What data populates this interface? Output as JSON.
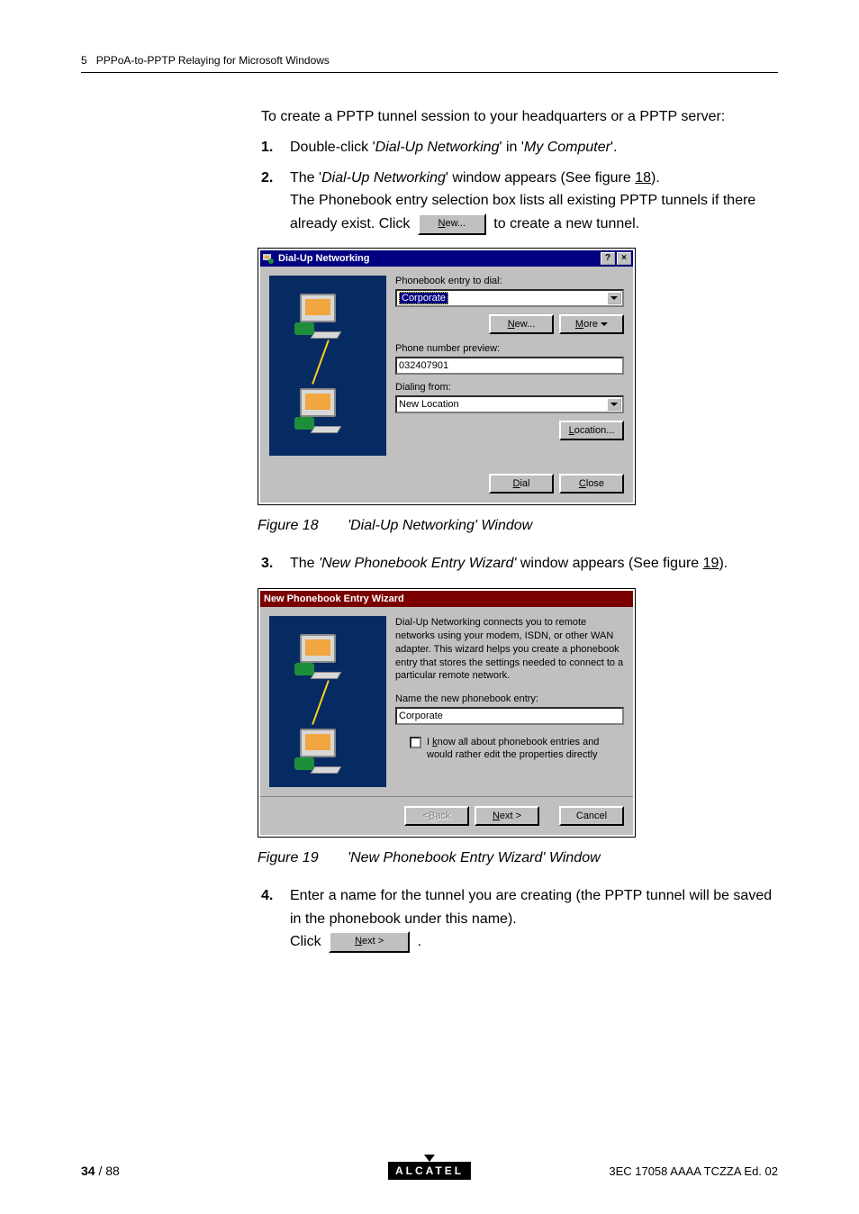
{
  "header": {
    "chapter_num": "5",
    "chapter_title": "PPPoA-to-PPTP Relaying for Microsoft Windows"
  },
  "intro": "To create a PPTP tunnel session to your headquarters or a PPTP server:",
  "steps": {
    "s1": {
      "num": "1.",
      "text_a": "Double-click '",
      "italic_1": "Dial-Up Networking",
      "text_b": "' in '",
      "italic_2": "My Computer",
      "text_c": "'."
    },
    "s2": {
      "num": "2.",
      "line1_a": "The '",
      "line1_i": "Dial-Up Networking",
      "line1_b": "' window appears (See figure ",
      "line1_link": "18",
      "line1_c": ").",
      "line2": "The Phonebook entry selection box lists all existing PPTP tunnels if there already exist. Click",
      "line2_btn_u": "N",
      "line2_btn_rest": "ew...",
      "line2_tail": "to create a new tunnel."
    },
    "s3": {
      "num": "3.",
      "text_a": "The ",
      "italic_1": "'New Phonebook Entry Wizard'",
      "text_b": " window appears (See figure ",
      "link": "19",
      "text_c": ")."
    },
    "s4": {
      "num": "4.",
      "line1": "Enter a name for the tunnel you are creating (the PPTP tunnel will be saved in the phonebook under this name).",
      "line2_pre": "Click",
      "btn_u": "N",
      "btn_rest": "ext >",
      "line2_post": "."
    }
  },
  "fig18": {
    "title": "Dial-Up Networking",
    "label_phonebook": "Phonebook entry to dial:",
    "combo_value": "Corporate",
    "btn_new_u": "N",
    "btn_new_rest": "ew...",
    "btn_more_u": "M",
    "btn_more_rest": "ore",
    "label_phone": "Phone number preview:",
    "phone_value": "032407901",
    "label_from": "Dialing from:",
    "from_value": "New Location",
    "btn_location_u": "L",
    "btn_location_rest": "ocation...",
    "btn_dial_u": "D",
    "btn_dial_rest": "ial",
    "btn_close_u": "C",
    "btn_close_rest": "lose",
    "caption_label": "Figure 18",
    "caption_text": "'Dial-Up Networking' Window"
  },
  "fig19": {
    "title": "New Phonebook Entry Wizard",
    "wiz_text": "Dial-Up Networking connects you to remote networks using your modem, ISDN, or other WAN adapter. This wizard helps you create a phonebook entry that stores the settings needed to connect to a particular remote network.",
    "label_name": "Name the new phonebook entry:",
    "entry_value": "Corporate",
    "check_label_a": "I ",
    "check_label_u": "k",
    "check_label_b": "now all about phonebook entries and would rather edit the properties directly",
    "btn_back_u": "B",
    "btn_back_rest": "ack",
    "btn_next_u": "N",
    "btn_next_rest": "ext >",
    "btn_cancel": "Cancel",
    "caption_label": "Figure 19",
    "caption_text": "'New Phonebook Entry Wizard' Window"
  },
  "footer": {
    "page": "34",
    "total": "88",
    "brand": "ALCATEL",
    "docid": "3EC 17058 AAAA TCZZA Ed. 02"
  }
}
